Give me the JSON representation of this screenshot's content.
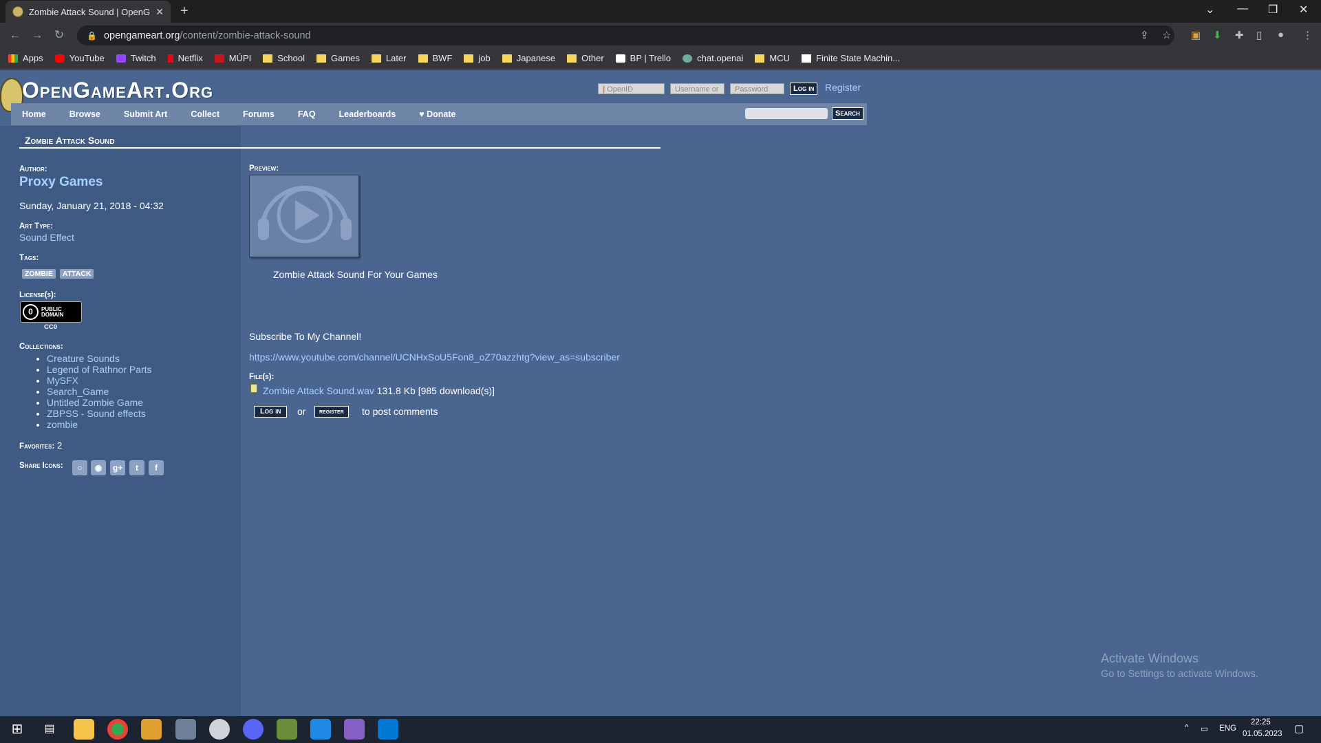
{
  "browser": {
    "tab_title": "Zombie Attack Sound | OpenGam",
    "tab_close": "✕",
    "new_tab": "+",
    "url_host": "opengameart.org",
    "url_path": "/content/zombie-attack-sound",
    "bookmarks": [
      {
        "label": "Apps",
        "icon": "apps-grid-icon",
        "color": "#ea4335"
      },
      {
        "label": "YouTube",
        "icon": "youtube-icon",
        "color": "#ff0000"
      },
      {
        "label": "Twitch",
        "icon": "twitch-icon",
        "color": "#9146ff"
      },
      {
        "label": "Netflix",
        "icon": "netflix-icon",
        "color": "#e50914"
      },
      {
        "label": "MÚPI",
        "icon": "mupi-icon",
        "color": "#c4161c"
      },
      {
        "label": "School",
        "icon": "folder-icon",
        "color": "#f6d65a"
      },
      {
        "label": "Games",
        "icon": "folder-icon",
        "color": "#f6d65a"
      },
      {
        "label": "Later",
        "icon": "folder-icon",
        "color": "#f6d65a"
      },
      {
        "label": "BWF",
        "icon": "folder-icon",
        "color": "#f6d65a"
      },
      {
        "label": "job",
        "icon": "folder-icon",
        "color": "#f6d65a"
      },
      {
        "label": "Japanese",
        "icon": "folder-icon",
        "color": "#f6d65a"
      },
      {
        "label": "Other",
        "icon": "folder-icon",
        "color": "#f6d65a"
      },
      {
        "label": "BP | Trello",
        "icon": "trello-icon",
        "color": "#ffffff"
      },
      {
        "label": "chat.openai",
        "icon": "openai-icon",
        "color": "#74aa9c"
      },
      {
        "label": "MCU",
        "icon": "folder-icon",
        "color": "#f6d65a"
      },
      {
        "label": "Finite State Machin...",
        "icon": "e-logo-icon",
        "color": "#ffffff"
      }
    ]
  },
  "site": {
    "logo": "OpenGameArt.Org",
    "login": {
      "openid_placeholder": "OpenID",
      "username_placeholder": "Username or",
      "password_placeholder": "Password",
      "login_button": "Log in",
      "register_link": "Register"
    },
    "nav": [
      "Home",
      "Browse",
      "Submit Art",
      "Collect",
      "Forums",
      "FAQ",
      "Leaderboards",
      "♥ Donate"
    ],
    "search_button": "Search"
  },
  "content": {
    "title": "Zombie Attack Sound",
    "author_label": "Author:",
    "author": "Proxy Games",
    "date": "Sunday, January 21, 2018 - 04:32",
    "art_type_label": "Art Type:",
    "art_type": "Sound Effect",
    "tags_label": "Tags:",
    "tags": [
      "ZOMBIE",
      "ATTACK"
    ],
    "license_label": "License(s):",
    "license_badge_line1": "PUBLIC",
    "license_badge_line2": "DOMAIN",
    "license_name": "CC0",
    "collections_label": "Collections:",
    "collections": [
      "Creature Sounds",
      "Legend of Rathnor Parts",
      "MySFX",
      "Search_Game",
      "Untitled Zombie Game",
      "ZBPSS - Sound effects",
      "zombie"
    ],
    "favorites_label": "Favorites:",
    "favorites": "2",
    "share_label": "Share Icons:",
    "share_icons": [
      "openid-share-icon",
      "reddit-share-icon",
      "google-plus-share-icon",
      "twitter-share-icon",
      "facebook-share-icon"
    ],
    "preview_label": "Preview:",
    "caption": "Zombie Attack Sound For Your Games",
    "subscribe": "Subscribe To My Channel!",
    "channel_url": "https://www.youtube.com/channel/UCNHxSoU5Fon8_oZ70azzhtg?view_as=subscriber",
    "files_label": "File(s):",
    "file_name": "Zombie Attack Sound.wav",
    "file_meta": "131.8 Kb [985 download(s)]",
    "comment_login": "Log in",
    "comment_or": "or",
    "comment_register": "register",
    "comment_suffix": "to post comments"
  },
  "windows": {
    "watermark_title": "Activate Windows",
    "watermark_sub": "Go to Settings to activate Windows.",
    "language": "ENG",
    "time": "22:25",
    "date": "01.05.2023"
  }
}
